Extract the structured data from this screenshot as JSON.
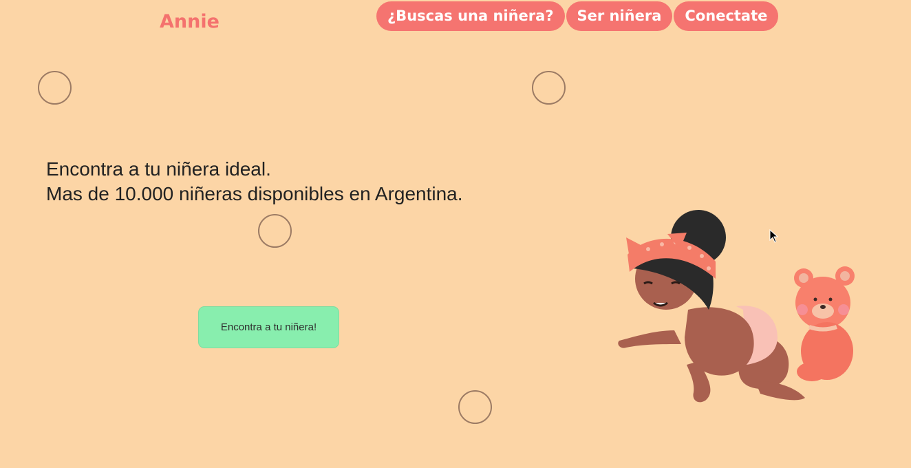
{
  "header": {
    "brand": "Annie",
    "nav": [
      {
        "label": "¿Buscas una niñera?"
      },
      {
        "label": "Ser niñera"
      },
      {
        "label": "Conectate"
      }
    ]
  },
  "hero": {
    "line1": "Encontra a tu niñera ideal.",
    "line2": "Mas de 10.000 niñeras disponibles en Argentina."
  },
  "cta": {
    "label": "Encontra a tu niñera!"
  },
  "illustration": {
    "subject": "crawling-baby-with-teddy-bear",
    "icon": "baby-illustration"
  },
  "colors": {
    "background": "#fcd5a6",
    "brand": "#f4726e",
    "nav_button": "#f57470",
    "cta": "#88eeae"
  }
}
